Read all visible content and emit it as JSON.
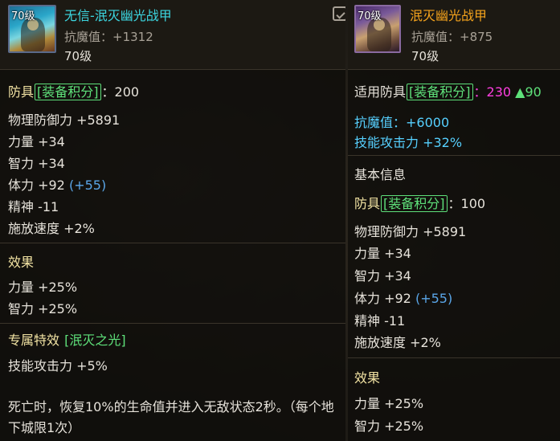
{
  "left": {
    "level_badge": "70级",
    "name": "无信-泯灭幽光战甲",
    "resist_label": "抗魔值：+1312",
    "level_text": "70级",
    "armor_prefix": "防具",
    "score_label": "[装备积分]",
    "score_sep": "：",
    "score_value": "200",
    "stats": [
      {
        "text": "物理防御力 +5891"
      },
      {
        "text": "力量 +34"
      },
      {
        "text": "智力 +34"
      },
      {
        "text": "体力 +92",
        "extra": "(+55)"
      },
      {
        "text": "精神 -11"
      },
      {
        "text": "施放速度 +2%"
      }
    ],
    "effect_title": "效果",
    "effects": [
      "力量 +25%",
      "智力 +25%"
    ],
    "special_title": "专属特效",
    "special_name": "[泯灭之光]",
    "special_effect": "技能攻击力 +5%",
    "description": "死亡时，恢复10%的生命值并进入无敌状态2秒。（每个地下城限1次）"
  },
  "right": {
    "level_badge": "70级",
    "name": "泯灭幽光战甲",
    "resist_label": "抗魔值：+875",
    "level_text": "70级",
    "applicable_prefix": "适用防具",
    "score_label": "[装备积分]",
    "score_sep": "：",
    "score_value": "230",
    "score_up": "▲90",
    "bonus": [
      "抗魔值：+6000",
      "技能攻击力 +32%"
    ],
    "base_title": "基本信息",
    "armor_prefix": "防具",
    "base_score_value": "100",
    "stats": [
      {
        "text": "物理防御力 +5891"
      },
      {
        "text": "力量 +34"
      },
      {
        "text": "智力 +34"
      },
      {
        "text": "体力 +92",
        "extra": "(+55)"
      },
      {
        "text": "精神 -11"
      },
      {
        "text": "施放速度 +2%"
      }
    ],
    "effect_title": "效果",
    "effects": [
      "力量 +25%",
      "智力 +25%"
    ]
  },
  "colors": {
    "left_name": "#3cd6e0",
    "right_name": "#f3a21c",
    "score_bracket": "#5ee07a",
    "section_title": "#f2e3a3",
    "score_highlight": "#ff3ee0",
    "bonus": "#56d0ff"
  },
  "icons": {
    "left_item": "armor-icon",
    "right_item": "armor-icon",
    "corner": "compare-icon"
  }
}
